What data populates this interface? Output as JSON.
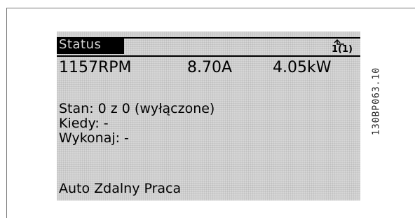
{
  "display": {
    "title": "Status",
    "menu_indicator": "1(1)",
    "readings": {
      "speed": "1157RPM",
      "current": "8.70A",
      "power": "4.05kW"
    },
    "lines": [
      "Stan: 0 z 0 (wyłączone)",
      "Kiedy: -",
      "Wykonaj: -",
      "Auto Zdalny Praca"
    ]
  },
  "figure_code": "130BP063.10"
}
